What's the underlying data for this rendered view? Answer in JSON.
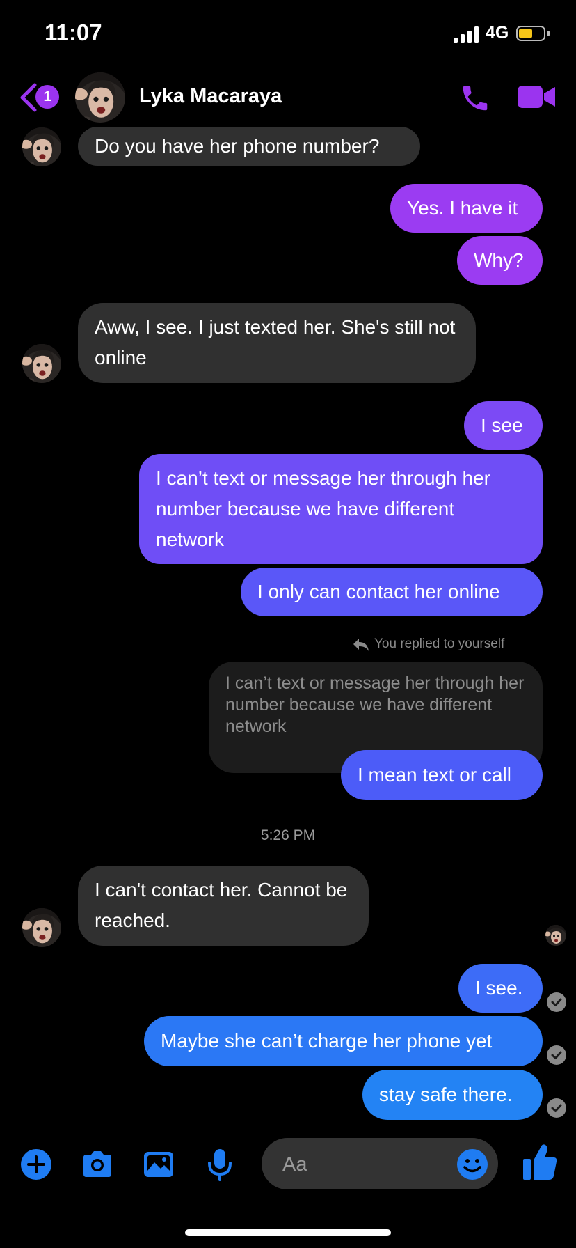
{
  "status_bar": {
    "time": "11:07",
    "network": "4G",
    "battery_fill": 0.55
  },
  "header": {
    "back_badge": "1",
    "contact_name": "Lyka Macaraya"
  },
  "messages": [
    {
      "from": "them",
      "text": "Do you have her phone number?"
    },
    {
      "from": "me",
      "text": "Yes. I have it"
    },
    {
      "from": "me",
      "text": "Why?"
    },
    {
      "from": "them",
      "text": "Aww, I see. I just texted her. She's still not online"
    },
    {
      "from": "me",
      "text": "I see"
    },
    {
      "from": "me",
      "text": "I can’t text or message her through her number because we have different network"
    },
    {
      "from": "me",
      "text": "I only can contact her online"
    },
    {
      "from": "me",
      "text": "I mean text or call"
    },
    {
      "from": "them",
      "text": "I can't contact her. Cannot be reached."
    },
    {
      "from": "me",
      "text": "I see."
    },
    {
      "from": "me",
      "text": "Maybe she can’t charge her phone yet"
    },
    {
      "from": "me",
      "text": "stay safe there."
    }
  ],
  "reply": {
    "label": "You replied to yourself",
    "quoted_text": "I can’t text or message her through her number because we have different network"
  },
  "timestamp": "5:26 PM",
  "composer": {
    "placeholder": "Aa"
  },
  "colors": {
    "accent_purple": "#9b34ef",
    "accent_blue": "#2383f4",
    "incoming_bubble": "#303030",
    "background": "#000000"
  },
  "icons": [
    "back-chevron-icon",
    "phone-icon",
    "video-camera-icon",
    "plus-icon",
    "camera-icon",
    "image-icon",
    "microphone-icon",
    "emoji-icon",
    "thumbs-up-icon",
    "check-icon",
    "reply-arrow-icon"
  ]
}
